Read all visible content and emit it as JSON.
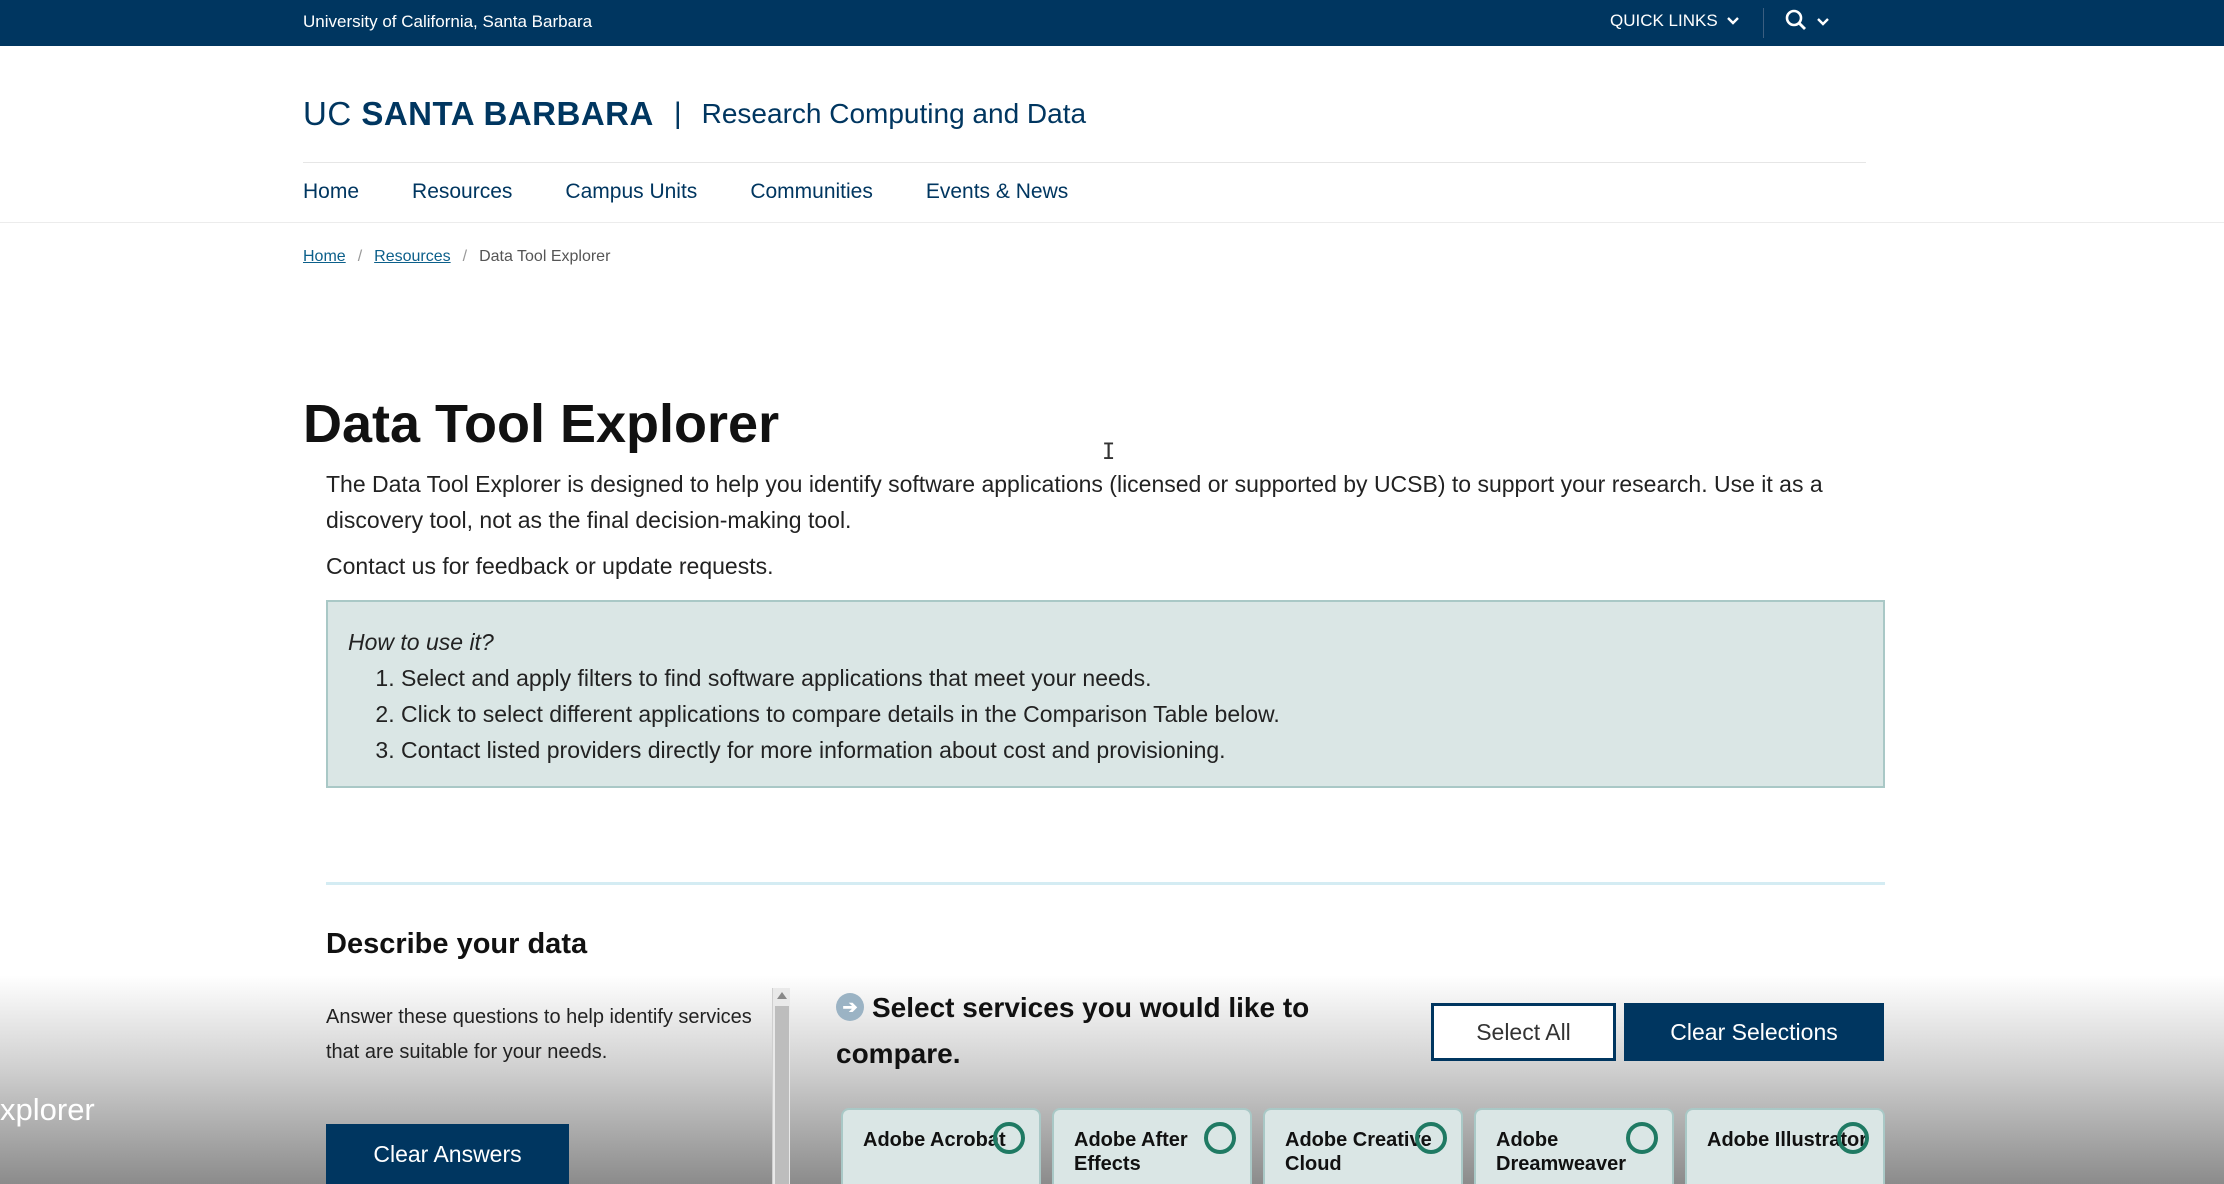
{
  "topbar": {
    "university": "University of California, Santa Barbara",
    "quick_links": "QUICK LINKS",
    "search_icon": "search-icon",
    "chevron_icon": "chevron-down-icon"
  },
  "brand": {
    "uc": "UC",
    "santa_barbara": "SANTA BARBARA",
    "separator": "|",
    "unit": "Research Computing and Data"
  },
  "nav": {
    "items": [
      "Home",
      "Resources",
      "Campus Units",
      "Communities",
      "Events & News"
    ]
  },
  "breadcrumb": {
    "home": "Home",
    "resources": "Resources",
    "current": "Data Tool Explorer",
    "sep": "/"
  },
  "page": {
    "title": "Data Tool Explorer",
    "intro": "The Data Tool Explorer is designed to help you identify software applications (licensed or supported by UCSB) to support your research. Use it as a discovery tool, not as the final decision-making tool.",
    "contact": "Contact us for feedback or update requests."
  },
  "howto": {
    "question": "How to use it?",
    "steps": [
      "Select and apply filters to find software applications that meet your needs.",
      "Click to select different applications to compare details in the Comparison Table below.",
      "Contact listed providers directly for more information about cost and provisioning."
    ]
  },
  "describe": {
    "heading": "Describe your data",
    "help": "Answer these questions to help identify services that are suitable for your needs.",
    "clear_answers": "Clear Answers"
  },
  "services": {
    "heading": "Select services you would like to compare.",
    "select_all": "Select All",
    "clear_selections": "Clear Selections",
    "cards": [
      {
        "name": "Adobe Acrobat"
      },
      {
        "name": "Adobe After Effects"
      },
      {
        "name": "Adobe Creative Cloud"
      },
      {
        "name": "Adobe Dreamweaver"
      },
      {
        "name": "Adobe Illustrator"
      }
    ]
  },
  "caption": "xplorer",
  "colors": {
    "brand_navy": "#003660",
    "info_bg": "#dae6e5",
    "ring_green": "#1f7a63"
  }
}
